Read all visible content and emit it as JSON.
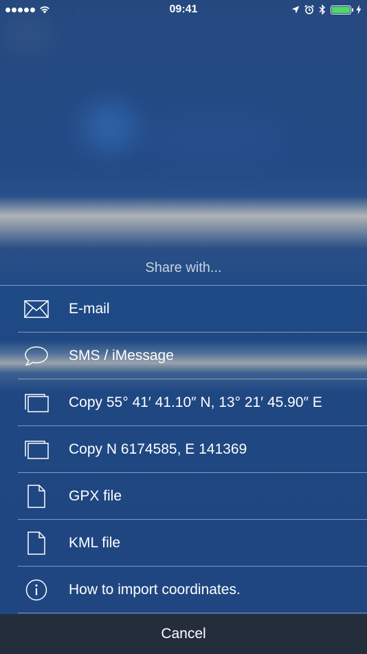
{
  "status_bar": {
    "time": "09:41",
    "signal_bars": 5,
    "battery_level": 1.0,
    "battery_color": "#4cd964"
  },
  "share": {
    "title": "Share with...",
    "items": [
      {
        "label": "E-mail",
        "icon": "envelope-icon"
      },
      {
        "label": "SMS / iMessage",
        "icon": "speech-bubble-icon"
      },
      {
        "label": "Copy 55° 41′ 41.10″ N, 13° 21′ 45.90″ E",
        "icon": "copy-icon"
      },
      {
        "label": "Copy N 6174585, E 141369",
        "icon": "copy-icon"
      },
      {
        "label": "GPX file",
        "icon": "document-icon"
      },
      {
        "label": "KML file",
        "icon": "document-icon"
      },
      {
        "label": "How to import coordinates.",
        "icon": "info-icon"
      }
    ],
    "cancel_label": "Cancel"
  },
  "colors": {
    "background": "#234a85",
    "cancel_bar": "#232d3c",
    "separator": "#ffffff"
  }
}
